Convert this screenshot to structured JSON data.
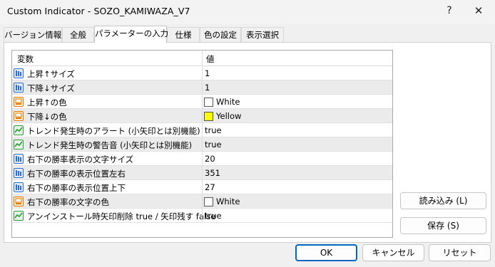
{
  "window": {
    "title": "Custom Indicator - SOZO_KAMIWAZA_V7",
    "help_label": "?",
    "close_label": "✕"
  },
  "tabs": [
    {
      "label": "バージョン情報"
    },
    {
      "label": "全般"
    },
    {
      "label": "パラメーターの入力"
    },
    {
      "label": "仕様"
    },
    {
      "label": "色の設定"
    },
    {
      "label": "表示選択"
    }
  ],
  "grid": {
    "columns": {
      "variable": "変数",
      "value": "値"
    },
    "rows": [
      {
        "icon": "int-icon",
        "name": "上昇↑サイズ",
        "value": "1"
      },
      {
        "icon": "int-icon",
        "name": "下降↓サイズ",
        "value": "1"
      },
      {
        "icon": "color-icon",
        "name": "上昇↑の色",
        "value": "White",
        "swatch": "#ffffff"
      },
      {
        "icon": "color-icon",
        "name": "下降↓の色",
        "value": "Yellow",
        "swatch": "#ffff00"
      },
      {
        "icon": "bool-icon",
        "name": "トレンド発生時のアラート (小矢印とは別機能)",
        "value": "true"
      },
      {
        "icon": "bool-icon",
        "name": "トレンド発生時の警告音 (小矢印とは別機能)",
        "value": "true"
      },
      {
        "icon": "int-icon",
        "name": "右下の勝率表示の文字サイズ",
        "value": "20"
      },
      {
        "icon": "int-icon",
        "name": "右下の勝率の表示位置左右",
        "value": "351"
      },
      {
        "icon": "int-icon",
        "name": "右下の勝率の表示位置上下",
        "value": "27"
      },
      {
        "icon": "color-icon",
        "name": "右下の勝率の文字の色",
        "value": "White",
        "swatch": "#ffffff"
      },
      {
        "icon": "bool-icon",
        "name": "アンインストール時矢印削除 true / 矢印残す false",
        "value": "true"
      }
    ]
  },
  "side_buttons": {
    "load": "読み込み (L)",
    "save": "保存 (S)"
  },
  "footer_buttons": {
    "ok": "OK",
    "cancel": "キャンセル",
    "reset": "リセット"
  },
  "colors": {
    "accent": "#0067c0",
    "alt_row": "#ebebeb",
    "int_icon": "#2f6fc4",
    "bool_icon": "#2e9a3a",
    "color_icon": "#e07b00"
  }
}
